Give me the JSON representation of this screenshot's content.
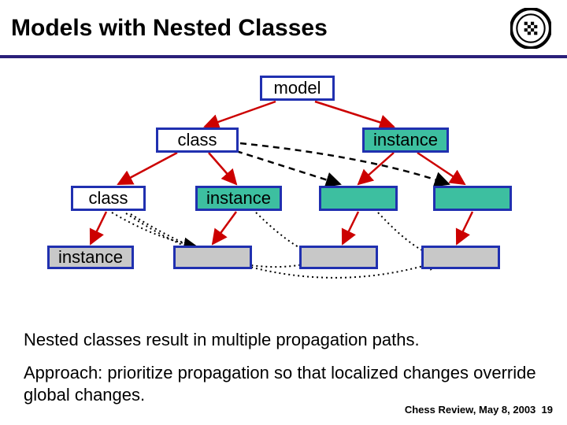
{
  "title": "Models with Nested Classes",
  "boxes": {
    "model": "model",
    "class_l2": "class",
    "instance_l2": "instance",
    "class_l3": "class",
    "instance_l3": "instance",
    "instance_l4": "instance"
  },
  "paragraph1": "Nested classes result in multiple propagation paths.",
  "paragraph2": "Approach: prioritize propagation so that localized changes override global changes.",
  "footer_text": "Chess Review, May 8, 2003",
  "footer_page": "19"
}
